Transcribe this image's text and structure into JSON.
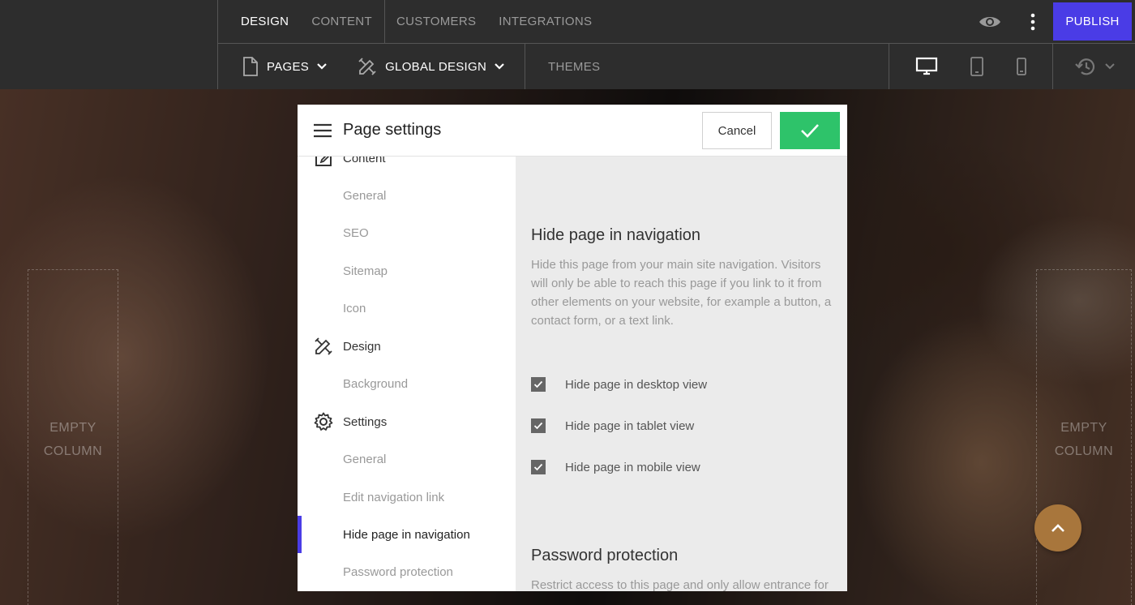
{
  "topbar": {
    "tabs_left": [
      {
        "label": "DESIGN",
        "active": true
      },
      {
        "label": "CONTENT",
        "active": false
      }
    ],
    "tabs_right": [
      {
        "label": "CUSTOMERS"
      },
      {
        "label": "INTEGRATIONS"
      }
    ],
    "publish_label": "PUBLISH",
    "pages_label": "PAGES",
    "global_design_label": "GLOBAL DESIGN",
    "themes_label": "THEMES",
    "accent_color": "#4a3ce6"
  },
  "background": {
    "empty_left": [
      "EMPTY",
      "COLUMN"
    ],
    "empty_right": [
      "EMPTY",
      "COLUMN"
    ]
  },
  "modal": {
    "title": "Page settings",
    "cancel_label": "Cancel",
    "confirm_color": "#2ec36a",
    "sidebar": {
      "content_label": "Content",
      "content_items": [
        "General",
        "SEO",
        "Sitemap",
        "Icon"
      ],
      "design_label": "Design",
      "design_items": [
        "Background"
      ],
      "settings_label": "Settings",
      "settings_items": [
        "General",
        "Edit navigation link",
        "Hide page in navigation",
        "Password protection"
      ],
      "selected": "Hide page in navigation"
    },
    "hide_section": {
      "title": "Hide page in navigation",
      "description": "Hide this page from your main site navigation. Visitors will only be able to reach this page if you link to it from other elements on your website, for example a button, a contact form, or a text link.",
      "options": [
        {
          "label": "Hide page in desktop view",
          "checked": true
        },
        {
          "label": "Hide page in tablet view",
          "checked": true
        },
        {
          "label": "Hide page in mobile view",
          "checked": true
        }
      ]
    },
    "password_section": {
      "title": "Password protection",
      "description": "Restrict access to this page and only allow entrance for"
    }
  },
  "icons": {
    "preview": "eye-icon",
    "more": "more-vertical-icon",
    "page": "page-icon",
    "global_design": "brush-ruler-icon",
    "desktop": "desktop-icon",
    "tablet": "tablet-icon",
    "mobile": "mobile-icon",
    "history": "history-icon",
    "menu": "hamburger-icon",
    "confirm": "check-icon",
    "scroll_top": "chevron-up-icon"
  }
}
